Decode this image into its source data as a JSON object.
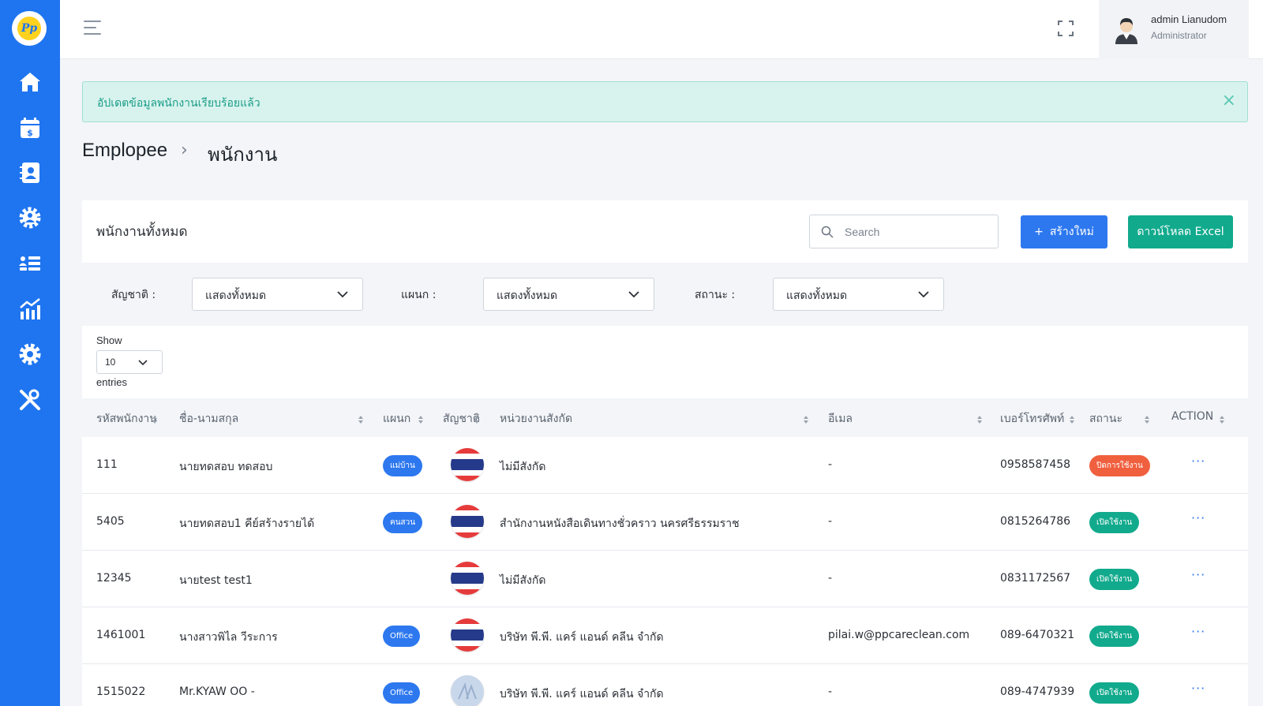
{
  "app": {
    "logo_text": "Pp",
    "colors": {
      "sidebar": "#1f75f0",
      "primary": "#2d78ef",
      "success": "#12aa8d",
      "danger": "#f0603f",
      "alert_bg": "#d8f3ee"
    }
  },
  "sidebar": {
    "items": [
      {
        "icon": "home-icon"
      },
      {
        "icon": "calendar-dollar-icon"
      },
      {
        "icon": "contact-book-icon"
      },
      {
        "icon": "employees-gear-icon"
      },
      {
        "icon": "list-users-icon"
      },
      {
        "icon": "chart-icon"
      },
      {
        "icon": "gear-icon"
      },
      {
        "icon": "tools-icon"
      }
    ]
  },
  "user": {
    "name": "admin Lianudom",
    "role": "Administrator"
  },
  "alert": {
    "message": "อัปเดตข้อมูลพนักงานเรียบร้อยแล้ว",
    "close": "×"
  },
  "breadcrumb": {
    "parent": "Emplopee",
    "separator": "›",
    "current": "พนักงาน"
  },
  "card": {
    "title": "พนักงานทั้งหมด",
    "search_placeholder": "Search",
    "create_label": "สร้างใหม่",
    "create_plus": "+",
    "excel_label": "ดาวน์โหลด Excel"
  },
  "filters": [
    {
      "label": "สัญชาติ :",
      "value": "แสดงทั้งหมด"
    },
    {
      "label": "แผนก :",
      "value": "แสดงทั้งหมด"
    },
    {
      "label": "สถานะ :",
      "value": "แสดงทั้งหมด"
    }
  ],
  "entries": {
    "show_label": "Show",
    "value": "10",
    "entries_label": "entries"
  },
  "table": {
    "columns": [
      "รหัสพนักงาน",
      "ชื่อ-นามสกุล",
      "แผนก",
      "สัญชาติ",
      "หน่วยงานสังกัด",
      "อีเมล",
      "เบอร์โทรศัพท์",
      "สถานะ",
      "ACTION"
    ],
    "rows": [
      {
        "id": "111",
        "name": "นายทดสอบ ทดสอบ",
        "dept": "แม่บ้าน",
        "nationality": "thai",
        "unit": "ไม่มีสังกัด",
        "email": "-",
        "phone": "0958587458",
        "status": "ปิดการใช้งาน",
        "status_type": "off",
        "action": "···"
      },
      {
        "id": "5405",
        "name": "นายทดสอบ1 คีย์สร้างรายได้",
        "dept": "คนสวน",
        "nationality": "thai",
        "unit": "สำนักงานหนังสือเดินทางชั่วคราว นครศรีธรรมราช",
        "email": "-",
        "phone": "0815264786",
        "status": "เปิดใช้งาน",
        "status_type": "on",
        "action": "···"
      },
      {
        "id": "12345",
        "name": "นายtest test1",
        "dept": "",
        "nationality": "thai",
        "unit": "ไม่มีสังกัด",
        "email": "-",
        "phone": "0831172567",
        "status": "เปิดใช้งาน",
        "status_type": "on",
        "action": "···"
      },
      {
        "id": "1461001",
        "name": "นางสาวพิไล วีระการ",
        "dept": "Office",
        "nationality": "thai",
        "unit": "บริษัท พี.พี. แคร์ แอนด์ คลีน จำกัด",
        "email": "pilai.w@ppcareclean.com",
        "phone": "089-6470321",
        "status": "เปิดใช้งาน",
        "status_type": "on",
        "action": "···"
      },
      {
        "id": "1515022",
        "name": "Mr.KYAW OO -",
        "dept": "Office",
        "nationality": "other",
        "unit": "บริษัท พี.พี. แคร์ แอนด์ คลีน จำกัด",
        "email": "-",
        "phone": "089-4747939",
        "status": "เปิดใช้งาน",
        "status_type": "on",
        "action": "···"
      }
    ]
  }
}
